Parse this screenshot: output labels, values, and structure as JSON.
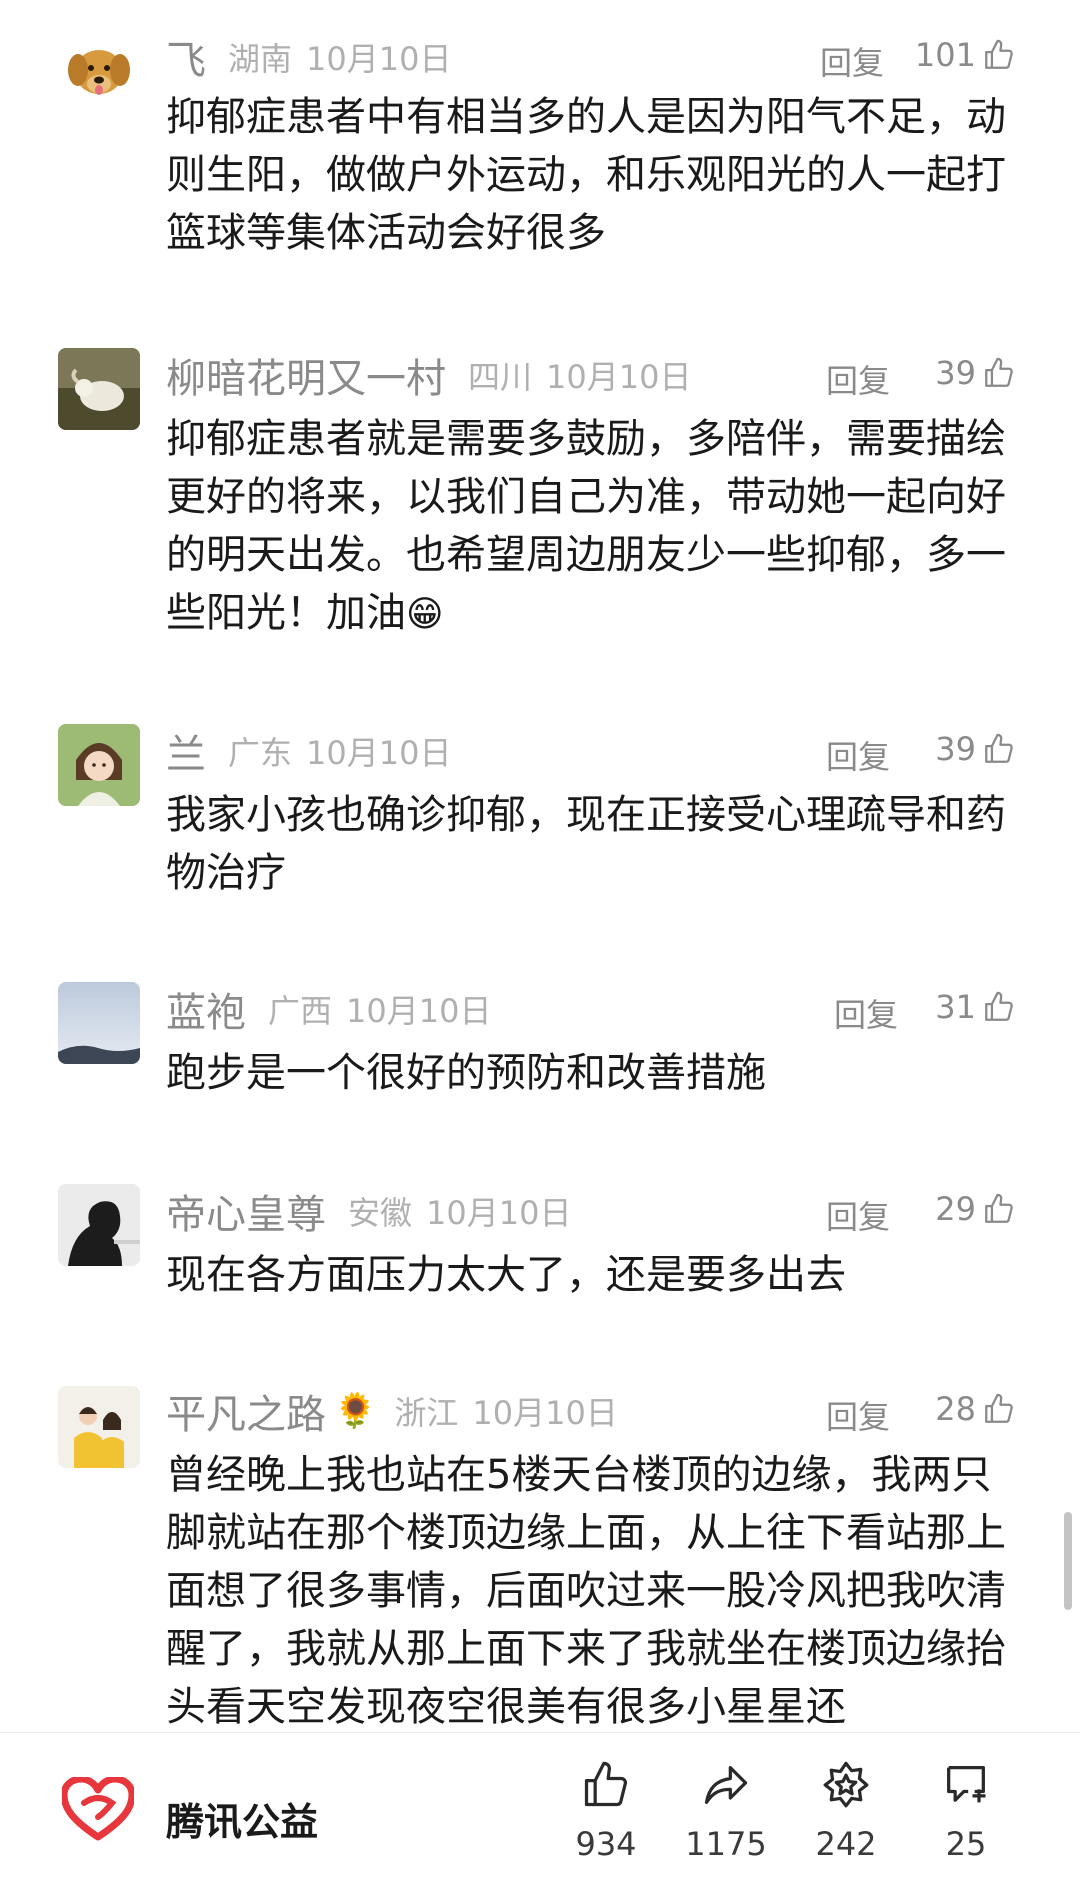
{
  "colors": {
    "brand_red": "#e8363d",
    "meta_gray": "#8a8a8a",
    "text_dark": "#1a1a1a"
  },
  "comments": [
    {
      "name": "飞",
      "region": "湖南",
      "date": "10月10日",
      "reply": "回复",
      "likes": "101",
      "text": "抑郁症患者中有相当多的人是因为阳气不足，动则生阳，做做户外运动，和乐观阳光的人一起打篮球等集体活动会好很多"
    },
    {
      "name": "柳暗花明又一村",
      "region": "四川",
      "date": "10月10日",
      "reply": "回复",
      "likes": "39",
      "text": "抑郁症患者就是需要多鼓励，多陪伴，需要描绘更好的将来，以我们自己为准，带动她一起向好的明天出发。也希望周边朋友少一些抑郁，多一些阳光！加油",
      "emoji": "😁"
    },
    {
      "name": "兰",
      "region": "广东",
      "date": "10月10日",
      "reply": "回复",
      "likes": "39",
      "text": "我家小孩也确诊抑郁，现在正接受心理疏导和药物治疗"
    },
    {
      "name": "蓝袍",
      "region": "广西",
      "date": "10月10日",
      "reply": "回复",
      "likes": "31",
      "text": "跑步是一个很好的预防和改善措施"
    },
    {
      "name": "帝心皇尊",
      "region": "安徽",
      "date": "10月10日",
      "reply": "回复",
      "likes": "29",
      "text": "现在各方面压力太大了，还是要多出去"
    },
    {
      "name": "平凡之路",
      "name_emoji": "🌻",
      "region": "浙江",
      "date": "10月10日",
      "reply": "回复",
      "likes": "28",
      "text": "曾经晚上我也站在5楼天台楼顶的边缘，我两只脚就站在那个楼顶边缘上面，从上往下看站那上面想了很多事情，后面吹过来一股冷风把我吹清醒了，我就从那上面下来了我就坐在楼顶边缘抬头看天空发现夜空很美有很多小星星还"
    }
  ],
  "bottom_bar": {
    "brand_name": "腾讯公益",
    "actions": [
      {
        "icon": "thumbs-up-icon",
        "count": "934"
      },
      {
        "icon": "share-icon",
        "count": "1175"
      },
      {
        "icon": "star-badge-icon",
        "count": "242"
      },
      {
        "icon": "comment-add-icon",
        "count": "25"
      }
    ]
  }
}
